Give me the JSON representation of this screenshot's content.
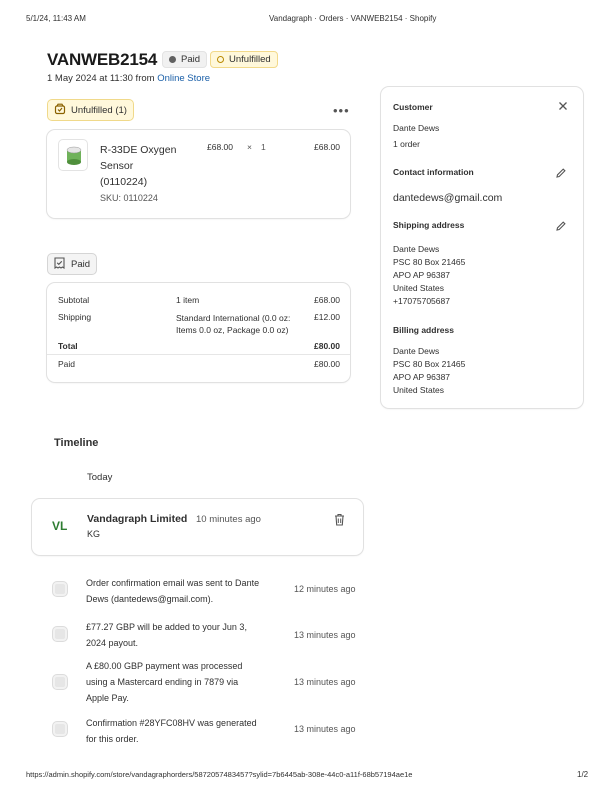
{
  "print_header": {
    "datetime": "5/1/24, 11:43 AM",
    "title": "Vandagraph · Orders · VANWEB2154 · Shopify"
  },
  "print_footer": {
    "url": "https://admin.shopify.com/store/vandagraphorders/5872057483457?sylid=7b6445ab-308e-44c0-a11f-68b57194ae1e",
    "page": "1/2"
  },
  "order": {
    "number": "VANWEB2154",
    "paid_badge": "Paid",
    "fulfillment_badge": "Unfulfilled",
    "date_text": "1 May 2024 at 11:30 from",
    "channel": "Online Store"
  },
  "fulfillment_card": {
    "header": "Unfulfilled (1)",
    "more_icon": "ellipsis-icon",
    "item": {
      "name_line1": "R-33DE Oxygen",
      "name_line2": "Sensor",
      "name_line3": "(0110224)",
      "sku": "SKU: 0110224",
      "unit_price": "£68.00",
      "times": "×",
      "qty": "1",
      "total": "£68.00"
    }
  },
  "payment_card": {
    "header": "Paid",
    "rows": [
      {
        "label": "Subtotal",
        "desc": "1 item",
        "amount": "£68.00"
      },
      {
        "label": "Shipping",
        "desc": "Standard International (0.0 oz:",
        "desc2": "Items 0.0 oz, Package 0.0 oz)",
        "amount": "£12.00"
      },
      {
        "label": "Total",
        "desc": "",
        "amount": "£80.00"
      },
      {
        "label": "Paid",
        "desc": "",
        "amount": "£80.00"
      }
    ]
  },
  "customer": {
    "header": "Customer",
    "name": "Dante Dews",
    "orders": "1 order",
    "contact_header": "Contact information",
    "email": "dantedews@gmail.com",
    "shipping_header": "Shipping address",
    "shipping_lines": [
      "Dante Dews",
      "PSC 80 Box 21465",
      "APO AP 96387",
      "United States",
      "+17075705687"
    ],
    "billing_header": "Billing address",
    "billing_lines": [
      "Dante Dews",
      "PSC 80 Box 21465",
      "APO AP 96387",
      "United States"
    ]
  },
  "timeline": {
    "title": "Timeline",
    "today": "Today",
    "comment": {
      "avatar": "VL",
      "author": "Vandagraph Limited",
      "time": "10 minutes ago",
      "text": "KG"
    },
    "events": [
      {
        "line1": "Order confirmation email was sent to Dante",
        "line2": "Dews (dantedews@gmail.com).",
        "line3": "",
        "time": "12 minutes ago"
      },
      {
        "line1": "£77.27 GBP will be added to your Jun 3,",
        "line2": "2024 payout.",
        "line3": "",
        "time": "13 minutes ago"
      },
      {
        "line1": "A £80.00 GBP payment was processed",
        "line2": "using a Mastercard ending in 7879 via",
        "line3": "Apple Pay.",
        "time": "13 minutes ago"
      },
      {
        "line1": "Confirmation #28YFC08HV was generated",
        "line2": "for this order.",
        "line3": "",
        "time": "13 minutes ago"
      }
    ]
  },
  "colors": {
    "link": "#1a5fa8",
    "avatar_text": "#2e7d32",
    "badge_dot_paid": "#616161",
    "badge_dot_unfulfilled": "#b98900"
  }
}
